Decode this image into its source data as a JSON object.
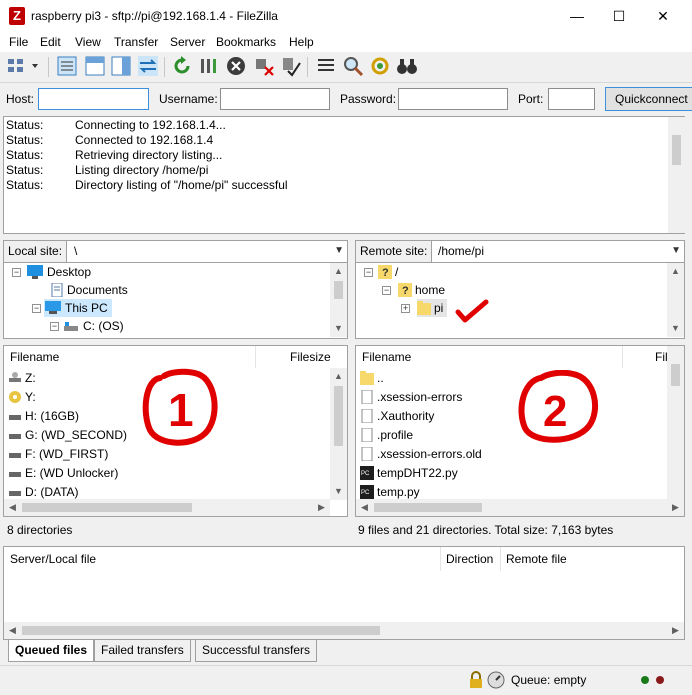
{
  "window": {
    "title": "raspberry pi3 - sftp://pi@192.168.1.4 - FileZilla",
    "minimize": "—",
    "maximize": "☐",
    "close": "✕"
  },
  "menu": [
    "File",
    "Edit",
    "View",
    "Transfer",
    "Server",
    "Bookmarks",
    "Help"
  ],
  "quickconnect": {
    "host_label": "Host:",
    "host_value": "",
    "username_label": "Username:",
    "username_value": "",
    "password_label": "Password:",
    "password_value": "",
    "port_label": "Port:",
    "port_value": "",
    "button": "Quickconnect"
  },
  "log": [
    {
      "k": "Status:",
      "v": "Connecting to 192.168.1.4..."
    },
    {
      "k": "Status:",
      "v": "Connected to 192.168.1.4"
    },
    {
      "k": "Status:",
      "v": "Retrieving directory listing..."
    },
    {
      "k": "Status:",
      "v": "Listing directory /home/pi"
    },
    {
      "k": "Status:",
      "v": "Directory listing of \"/home/pi\" successful"
    }
  ],
  "local": {
    "site_label": "Local site:",
    "path": "\\",
    "tree": [
      "Desktop",
      "Documents",
      "This PC",
      "C: (OS)"
    ],
    "col_filename": "Filename",
    "col_filesize": "Filesize",
    "files": [
      "Z:",
      "Y:",
      "H: (16GB)",
      "G: (WD_SECOND)",
      "F: (WD_FIRST)",
      "E: (WD Unlocker)",
      "D: (DATA)"
    ],
    "status": "8 directories"
  },
  "remote": {
    "site_label": "Remote site:",
    "path": "/home/pi",
    "tree": [
      "/",
      "home",
      "pi"
    ],
    "col_filename": "Filename",
    "col_filesize": "Fil",
    "files": [
      "..",
      ".xsession-errors",
      ".Xauthority",
      ".profile",
      ".xsession-errors.old",
      "tempDHT22.py",
      "temp.py"
    ],
    "status": "9 files and 21 directories. Total size: 7,163 bytes"
  },
  "queue": {
    "col_file": "Server/Local file",
    "col_direction": "Direction",
    "col_remote": "Remote file"
  },
  "tabs": [
    "Queued files",
    "Failed transfers",
    "Successful transfers"
  ],
  "bottom": {
    "queue": "Queue: empty"
  },
  "annotations": {
    "one": "1",
    "two": "2"
  },
  "colors": {
    "annotation": "#e00000",
    "folder": "#f7d86a",
    "selection": "#cce8ff",
    "accent": "#3c8fd8"
  }
}
